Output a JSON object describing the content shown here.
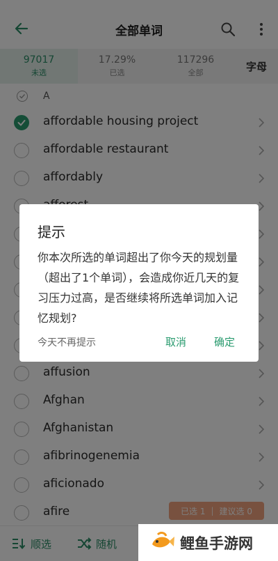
{
  "header": {
    "title": "全部单词",
    "back_icon": "arrow-left-icon",
    "search_icon": "search-icon",
    "more_icon": "more-vertical-icon"
  },
  "stats": {
    "unselected": {
      "value": "97017",
      "label": "未选"
    },
    "selected": {
      "value": "17.29%",
      "label": "已选"
    },
    "all": {
      "value": "117296",
      "label": "全部"
    },
    "letter_tab": "字母"
  },
  "group": {
    "letter": "A"
  },
  "words": [
    {
      "text": "affordable housing project",
      "checked": true
    },
    {
      "text": "affordable restaurant",
      "checked": false
    },
    {
      "text": "affordably",
      "checked": false
    },
    {
      "text": "afforest",
      "checked": false
    },
    {
      "text": "",
      "checked": false
    },
    {
      "text": "",
      "checked": false
    },
    {
      "text": "",
      "checked": false
    },
    {
      "text": "",
      "checked": false
    },
    {
      "text": "",
      "checked": false
    },
    {
      "text": "affusion",
      "checked": false
    },
    {
      "text": "Afghan",
      "checked": false
    },
    {
      "text": "Afghanistan",
      "checked": false
    },
    {
      "text": "afibrinogenemia",
      "checked": false
    },
    {
      "text": "aficionado",
      "checked": false
    },
    {
      "text": "afire",
      "checked": false
    }
  ],
  "selected_pill": {
    "selected": "已选 1",
    "separator": "|",
    "suggested": "建议选 0"
  },
  "bottom": {
    "sequential": "顺选",
    "random": "随机"
  },
  "dialog": {
    "title": "提示",
    "message": "你本次所选的单词超出了你今天的规划量（超出了1个单词），会造成你近几天的复习压力过高，是否继续将所选单词加入记忆规划?",
    "dismiss": "今天不再提示",
    "cancel": "取消",
    "confirm": "确定"
  },
  "watermark": {
    "text": "鲤鱼手游网"
  },
  "colors": {
    "accent": "#2a9b6f",
    "pill": "#f0a37e",
    "overlay": "rgba(0,0,0,0.5)"
  }
}
